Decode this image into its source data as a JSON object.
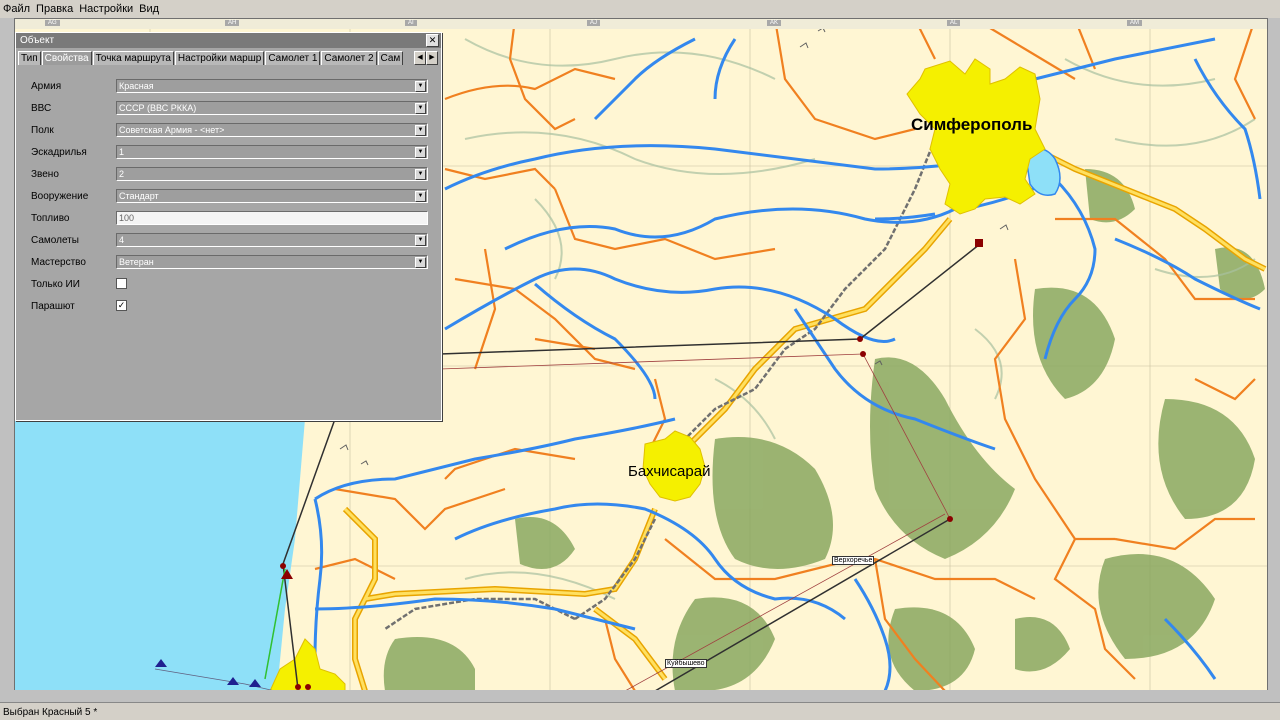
{
  "menu": [
    "Файл",
    "Правка",
    "Настройки",
    "Вид"
  ],
  "map": {
    "grid_columns": [
      "AG",
      "AH",
      "AI",
      "AJ",
      "AK",
      "AL",
      "AM"
    ],
    "cities": {
      "simferopol": "Симферополь",
      "bakhchisaray": "Бахчисарай"
    },
    "small_labels": {
      "verkhorechye": "Верхоречье",
      "kuibyshevo": "Куйбышево"
    },
    "colors": {
      "background": "#fff6d3",
      "river": "#3388ee",
      "road": "#f08020",
      "city": "#f5f000",
      "forest": "#7aa050",
      "sea": "#8ee0f8"
    }
  },
  "dialog": {
    "title": "Объект",
    "tabs": [
      "Тип",
      "Свойства",
      "Точка маршрута",
      "Настройки маршр",
      "Самолет 1",
      "Самолет 2",
      "Сам"
    ],
    "active_tab": "Свойства",
    "fields": {
      "army": {
        "label": "Армия",
        "value": "Красная"
      },
      "airforce": {
        "label": "ВВС",
        "value": "СССР (ВВС РККА)"
      },
      "regiment": {
        "label": "Полк",
        "value": "Советская Армия - <нет>"
      },
      "squadron": {
        "label": "Эскадрилья",
        "value": "1"
      },
      "flight": {
        "label": "Звено",
        "value": "2"
      },
      "weapons": {
        "label": "Вооружение",
        "value": "Стандарт"
      },
      "fuel": {
        "label": "Топливо",
        "value": "100"
      },
      "planes": {
        "label": "Самолеты",
        "value": "4"
      },
      "skill": {
        "label": "Мастерство",
        "value": "Ветеран"
      },
      "ai_only": {
        "label": "Только ИИ",
        "checked": false
      },
      "parachute": {
        "label": "Парашют",
        "checked": true
      }
    }
  },
  "status": "Выбран Красный 5 *"
}
